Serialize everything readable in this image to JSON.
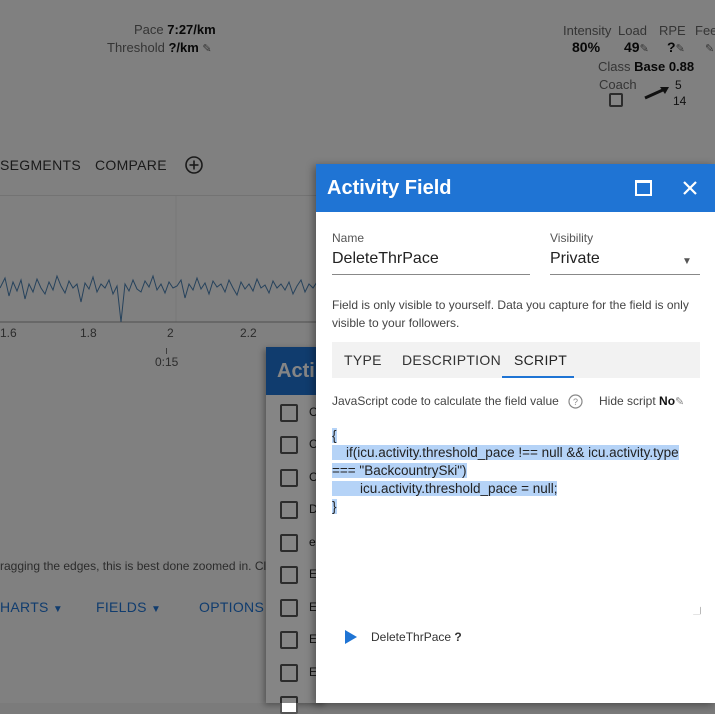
{
  "header": {
    "pace_label": "Pace",
    "pace_value": "7:27/km",
    "threshold_label": "Threshold",
    "threshold_value": "?/km",
    "metrics": [
      {
        "label": "Intensity",
        "value": "80%"
      },
      {
        "label": "Load",
        "value": "49"
      },
      {
        "label": "RPE",
        "value": "?"
      },
      {
        "label": "Fee",
        "value": ""
      }
    ],
    "class_label": "Class",
    "class_value": "Base 0.88",
    "coach_label": "Coach",
    "trend_top": "5",
    "trend_bottom": "14"
  },
  "tabs": {
    "segments": "SEGMENTS",
    "compare": "COMPARE"
  },
  "chart_axis": {
    "ticks": [
      "1.6",
      "1.8",
      "2",
      "2.2"
    ],
    "time_tick": "0:15"
  },
  "hint_text": "ragging the edges, this is best done zoomed in. Cli",
  "toolbar": {
    "charts": "HARTS",
    "fields": "FIELDS",
    "options": "OPTIONS"
  },
  "behind_dialog": {
    "title": "Acti",
    "items": [
      "C",
      "C",
      "C",
      "D",
      "e",
      "E",
      "E",
      "E",
      "E",
      ""
    ]
  },
  "dialog": {
    "title": "Activity Field",
    "name_label": "Name",
    "name_value": "DeleteThrPace",
    "visibility_label": "Visibility",
    "visibility_value": "Private",
    "info_text": "Field is only visible to yourself. Data you capture for the field is only visible to your followers.",
    "tabs": [
      "TYPE",
      "DESCRIPTION",
      "SCRIPT"
    ],
    "active_tab": "SCRIPT",
    "script_label": "JavaScript code to calculate the field value",
    "hide_script_label": "Hide script",
    "hide_script_value": "No",
    "code_lines": [
      "{",
      "if(icu.activity.threshold_pace !== null && icu.activity.type",
      "=== \"BackcountrySki\")",
      "icu.activity.threshold_pace = null;",
      "}"
    ],
    "run_target": "DeleteThrPace",
    "run_result": "?"
  },
  "colors": {
    "header_blue": "#1f74d4",
    "selection": "#b5d3f7",
    "tab_underline": "#1f74d4"
  }
}
